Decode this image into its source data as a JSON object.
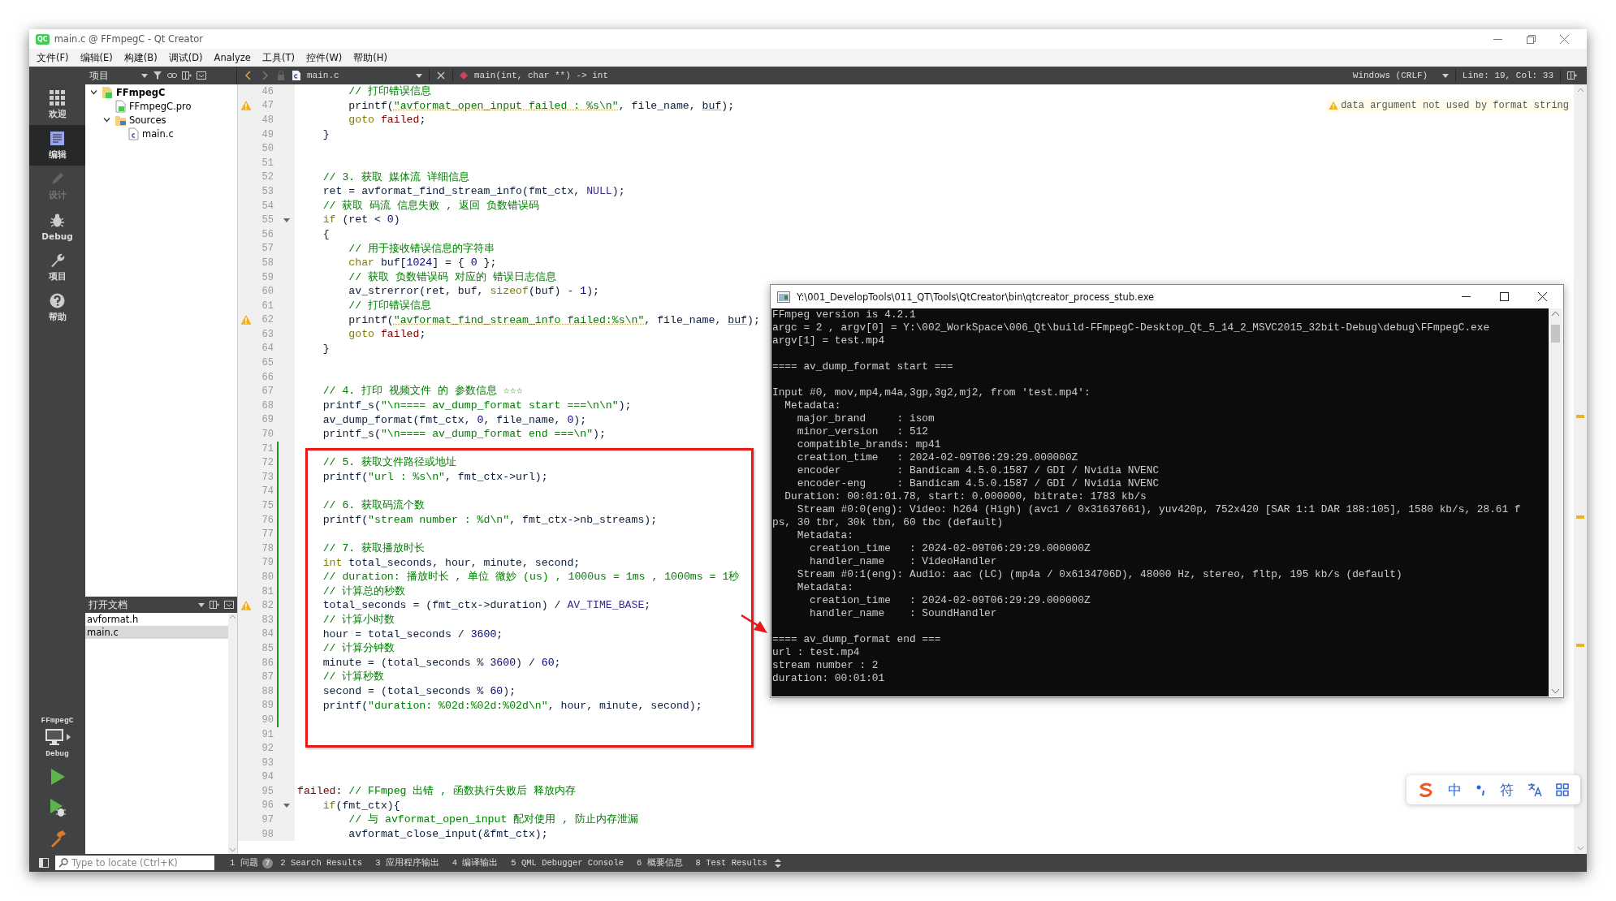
{
  "window": {
    "logo": "QC",
    "title": "main.c @ FFmpegC - Qt Creator"
  },
  "menu": [
    "文件(F)",
    "编辑(E)",
    "构建(B)",
    "调试(D)",
    "Analyze",
    "工具(T)",
    "控件(W)",
    "帮助(H)"
  ],
  "toolbar": {
    "panel_label": "项目",
    "file": "main.c",
    "symbol": "main(int, char **) -> int",
    "line_ending": "Windows (CRLF)",
    "position": "Line: 19, Col: 33"
  },
  "mode_bar": {
    "items": [
      {
        "label": "欢迎",
        "selected": false,
        "disabled": false
      },
      {
        "label": "编辑",
        "selected": true,
        "disabled": false
      },
      {
        "label": "设计",
        "selected": false,
        "disabled": true
      },
      {
        "label": "Debug",
        "selected": false,
        "disabled": false
      },
      {
        "label": "项目",
        "selected": false,
        "disabled": false
      },
      {
        "label": "帮助",
        "selected": false,
        "disabled": false
      }
    ],
    "kit": {
      "project": "FFmpegC",
      "build": "Debug"
    }
  },
  "project_tree": [
    {
      "label": "FFmpegC",
      "kind": "project",
      "expanded": true,
      "children": [
        {
          "label": "FFmpegC.pro",
          "kind": "pro"
        },
        {
          "label": "Sources",
          "kind": "folder",
          "expanded": true,
          "children": [
            {
              "label": "main.c",
              "kind": "source"
            }
          ]
        }
      ]
    }
  ],
  "open_documents": {
    "title": "打开文档",
    "items": [
      {
        "label": "avformat.h",
        "selected": false
      },
      {
        "label": "main.c",
        "selected": true
      }
    ]
  },
  "code": {
    "lines": [
      {
        "number": "46",
        "warning": false,
        "changed": false,
        "foldable": false,
        "segments": [
          {
            "kind": "comment",
            "text": "        // 打印错误信息"
          }
        ]
      },
      {
        "number": "47",
        "warning": true,
        "changed": false,
        "foldable": false,
        "annotation": "data argument not used by format string",
        "segments": [
          {
            "kind": "plain",
            "text": "        printf("
          },
          {
            "kind": "warn_string",
            "text": "\"avformat_open_input failed : %s\\n\""
          },
          {
            "kind": "plain",
            "text": ", file_name, "
          },
          {
            "kind": "warn_plain",
            "text": "buf"
          },
          {
            "kind": "plain",
            "text": ");"
          }
        ]
      },
      {
        "number": "48",
        "warning": false,
        "changed": false,
        "foldable": false,
        "segments": [
          {
            "kind": "keyword",
            "text": "        goto "
          },
          {
            "kind": "label",
            "text": "failed"
          },
          {
            "kind": "plain",
            "text": ";"
          }
        ]
      },
      {
        "number": "49",
        "warning": false,
        "changed": false,
        "foldable": false,
        "segments": [
          {
            "kind": "plain",
            "text": "    }"
          }
        ]
      },
      {
        "number": "50",
        "warning": false,
        "changed": false,
        "foldable": false
      },
      {
        "number": "51",
        "warning": false,
        "changed": false,
        "foldable": false
      },
      {
        "number": "52",
        "warning": false,
        "changed": false,
        "foldable": false,
        "segments": [
          {
            "kind": "comment",
            "text": "    // 3. 获取 媒体流 详细信息"
          }
        ]
      },
      {
        "number": "53",
        "warning": false,
        "changed": false,
        "foldable": false,
        "segments": [
          {
            "kind": "plain",
            "text": "    ret = avformat_find_stream_info(fmt_ctx, "
          },
          {
            "kind": "macro",
            "text": "NULL"
          },
          {
            "kind": "plain",
            "text": ");"
          }
        ]
      },
      {
        "number": "54",
        "warning": false,
        "changed": false,
        "foldable": false,
        "segments": [
          {
            "kind": "comment",
            "text": "    // 获取 码流 信息失败 , 返回 负数错误码"
          }
        ]
      },
      {
        "number": "55",
        "warning": false,
        "changed": false,
        "foldable": true,
        "segments": [
          {
            "kind": "keyword",
            "text": "    if"
          },
          {
            "kind": "plain",
            "text": " (ret < "
          },
          {
            "kind": "number",
            "text": "0"
          },
          {
            "kind": "plain",
            "text": ")"
          }
        ]
      },
      {
        "number": "56",
        "warning": false,
        "changed": false,
        "foldable": false,
        "segments": [
          {
            "kind": "plain",
            "text": "    {"
          }
        ]
      },
      {
        "number": "57",
        "warning": false,
        "changed": false,
        "foldable": false,
        "segments": [
          {
            "kind": "comment",
            "text": "        // 用于接收错误信息的字符串"
          }
        ]
      },
      {
        "number": "58",
        "warning": false,
        "changed": false,
        "foldable": false,
        "segments": [
          {
            "kind": "keyword",
            "text": "        char"
          },
          {
            "kind": "plain",
            "text": " buf["
          },
          {
            "kind": "number",
            "text": "1024"
          },
          {
            "kind": "plain",
            "text": "] = { "
          },
          {
            "kind": "number",
            "text": "0"
          },
          {
            "kind": "plain",
            "text": " };"
          }
        ]
      },
      {
        "number": "59",
        "warning": false,
        "changed": false,
        "foldable": false,
        "segments": [
          {
            "kind": "comment",
            "text": "        // 获取 负数错误码 对应的 错误日志信息"
          }
        ]
      },
      {
        "number": "60",
        "warning": false,
        "changed": false,
        "foldable": false,
        "segments": [
          {
            "kind": "plain",
            "text": "        av_strerror(ret, buf, "
          },
          {
            "kind": "keyword",
            "text": "sizeof"
          },
          {
            "kind": "plain",
            "text": "(buf) - "
          },
          {
            "kind": "number",
            "text": "1"
          },
          {
            "kind": "plain",
            "text": ");"
          }
        ]
      },
      {
        "number": "61",
        "warning": false,
        "changed": false,
        "foldable": false,
        "segments": [
          {
            "kind": "comment",
            "text": "        // 打印错误信息"
          }
        ]
      },
      {
        "number": "62",
        "warning": true,
        "changed": false,
        "foldable": false,
        "segments": [
          {
            "kind": "plain",
            "text": "        printf("
          },
          {
            "kind": "warn_string",
            "text": "\"avformat_find_stream_info failed:%s\\n\""
          },
          {
            "kind": "plain",
            "text": ", file_name, "
          },
          {
            "kind": "warn_plain",
            "text": "buf"
          },
          {
            "kind": "plain",
            "text": ");"
          }
        ]
      },
      {
        "number": "63",
        "warning": false,
        "changed": false,
        "foldable": false,
        "segments": [
          {
            "kind": "keyword",
            "text": "        goto "
          },
          {
            "kind": "label",
            "text": "failed"
          },
          {
            "kind": "plain",
            "text": ";"
          }
        ]
      },
      {
        "number": "64",
        "warning": false,
        "changed": false,
        "foldable": false,
        "segments": [
          {
            "kind": "plain",
            "text": "    }"
          }
        ]
      },
      {
        "number": "65",
        "warning": false,
        "changed": false,
        "foldable": false
      },
      {
        "number": "66",
        "warning": false,
        "changed": false,
        "foldable": false
      },
      {
        "number": "67",
        "warning": false,
        "changed": false,
        "foldable": false,
        "segments": [
          {
            "kind": "comment",
            "text": "    // 4. 打印 视频文件 的 参数信息 ☆☆☆"
          }
        ]
      },
      {
        "number": "68",
        "warning": false,
        "changed": false,
        "foldable": false,
        "segments": [
          {
            "kind": "plain",
            "text": "    printf_s("
          },
          {
            "kind": "string",
            "text": "\"\\n==== av_dump_format start ===\\n\\n\""
          },
          {
            "kind": "plain",
            "text": ");"
          }
        ]
      },
      {
        "number": "69",
        "warning": false,
        "changed": false,
        "foldable": false,
        "segments": [
          {
            "kind": "plain",
            "text": "    av_dump_format(fmt_ctx, "
          },
          {
            "kind": "number",
            "text": "0"
          },
          {
            "kind": "plain",
            "text": ", file_name, "
          },
          {
            "kind": "number",
            "text": "0"
          },
          {
            "kind": "plain",
            "text": ");"
          }
        ]
      },
      {
        "number": "70",
        "warning": false,
        "changed": false,
        "foldable": false,
        "segments": [
          {
            "kind": "plain",
            "text": "    printf_s("
          },
          {
            "kind": "string",
            "text": "\"\\n==== av_dump_format end ===\\n\""
          },
          {
            "kind": "plain",
            "text": ");"
          }
        ]
      },
      {
        "number": "71",
        "warning": false,
        "changed": true,
        "foldable": false
      },
      {
        "number": "72",
        "warning": false,
        "changed": true,
        "foldable": false,
        "segments": [
          {
            "kind": "comment",
            "text": "    // 5. 获取文件路径或地址"
          }
        ]
      },
      {
        "number": "73",
        "warning": false,
        "changed": true,
        "foldable": false,
        "segments": [
          {
            "kind": "plain",
            "text": "    printf("
          },
          {
            "kind": "string",
            "text": "\"url : %s\\n\""
          },
          {
            "kind": "plain",
            "text": ", fmt_ctx->url);"
          }
        ]
      },
      {
        "number": "74",
        "warning": false,
        "changed": true,
        "foldable": false
      },
      {
        "number": "75",
        "warning": false,
        "changed": true,
        "foldable": false,
        "segments": [
          {
            "kind": "comment",
            "text": "    // 6. 获取码流个数"
          }
        ]
      },
      {
        "number": "76",
        "warning": false,
        "changed": true,
        "foldable": false,
        "segments": [
          {
            "kind": "plain",
            "text": "    printf("
          },
          {
            "kind": "string",
            "text": "\"stream number : %d\\n\""
          },
          {
            "kind": "plain",
            "text": ", fmt_ctx->nb_streams);"
          }
        ]
      },
      {
        "number": "77",
        "warning": false,
        "changed": true,
        "foldable": false
      },
      {
        "number": "78",
        "warning": false,
        "changed": true,
        "foldable": false,
        "segments": [
          {
            "kind": "comment",
            "text": "    // 7. 获取播放时长"
          }
        ]
      },
      {
        "number": "79",
        "warning": false,
        "changed": true,
        "foldable": false,
        "segments": [
          {
            "kind": "keyword",
            "text": "    int"
          },
          {
            "kind": "plain",
            "text": " total_seconds, hour, minute, second;"
          }
        ]
      },
      {
        "number": "80",
        "warning": false,
        "changed": true,
        "foldable": false,
        "segments": [
          {
            "kind": "comment",
            "text": "    // duration: 播放时长 , 单位 微妙 (us) , 1000us = 1ms , 1000ms = 1秒"
          }
        ]
      },
      {
        "number": "81",
        "warning": false,
        "changed": true,
        "foldable": false,
        "segments": [
          {
            "kind": "comment",
            "text": "    // 计算总的秒数"
          }
        ]
      },
      {
        "number": "82",
        "warning": true,
        "changed": true,
        "foldable": false,
        "segments": [
          {
            "kind": "plain",
            "text": "    total_seconds = (fmt_ctx->duration) / "
          },
          {
            "kind": "macro",
            "text": "AV_TIME_BASE"
          },
          {
            "kind": "plain",
            "text": ";"
          }
        ]
      },
      {
        "number": "83",
        "warning": false,
        "changed": true,
        "foldable": false,
        "segments": [
          {
            "kind": "comment",
            "text": "    // 计算小时数"
          }
        ]
      },
      {
        "number": "84",
        "warning": false,
        "changed": true,
        "foldable": false,
        "segments": [
          {
            "kind": "plain",
            "text": "    hour = total_seconds / "
          },
          {
            "kind": "number",
            "text": "3600"
          },
          {
            "kind": "plain",
            "text": ";"
          }
        ]
      },
      {
        "number": "85",
        "warning": false,
        "changed": true,
        "foldable": false,
        "segments": [
          {
            "kind": "comment",
            "text": "    // 计算分钟数"
          }
        ]
      },
      {
        "number": "86",
        "warning": false,
        "changed": true,
        "foldable": false,
        "segments": [
          {
            "kind": "plain",
            "text": "    minute = (total_seconds % "
          },
          {
            "kind": "number",
            "text": "3600"
          },
          {
            "kind": "plain",
            "text": ") / "
          },
          {
            "kind": "number",
            "text": "60"
          },
          {
            "kind": "plain",
            "text": ";"
          }
        ]
      },
      {
        "number": "87",
        "warning": false,
        "changed": true,
        "foldable": false,
        "segments": [
          {
            "kind": "comment",
            "text": "    // 计算秒数"
          }
        ]
      },
      {
        "number": "88",
        "warning": false,
        "changed": true,
        "foldable": false,
        "segments": [
          {
            "kind": "plain",
            "text": "    second = (total_seconds % "
          },
          {
            "kind": "number",
            "text": "60"
          },
          {
            "kind": "plain",
            "text": ");"
          }
        ]
      },
      {
        "number": "89",
        "warning": false,
        "changed": true,
        "foldable": false,
        "segments": [
          {
            "kind": "plain",
            "text": "    printf("
          },
          {
            "kind": "string",
            "text": "\"duration: %02d:%02d:%02d\\n\""
          },
          {
            "kind": "plain",
            "text": ", hour, minute, second);"
          }
        ]
      },
      {
        "number": "90",
        "warning": false,
        "changed": true,
        "foldable": false
      },
      {
        "number": "91",
        "warning": false,
        "changed": false,
        "foldable": false
      },
      {
        "number": "92",
        "warning": false,
        "changed": false,
        "foldable": false
      },
      {
        "number": "93",
        "warning": false,
        "changed": false,
        "foldable": false
      },
      {
        "number": "94",
        "warning": false,
        "changed": false,
        "foldable": false
      },
      {
        "number": "95",
        "warning": false,
        "changed": false,
        "foldable": false,
        "segments": [
          {
            "kind": "label",
            "text": "failed"
          },
          {
            "kind": "plain",
            "text": ": "
          },
          {
            "kind": "comment",
            "text": "// FFmpeg 出错 , 函数执行失败后 释放内存"
          }
        ]
      },
      {
        "number": "96",
        "warning": false,
        "changed": false,
        "foldable": true,
        "segments": [
          {
            "kind": "keyword",
            "text": "    if"
          },
          {
            "kind": "plain",
            "text": "(fmt_ctx){"
          }
        ]
      },
      {
        "number": "97",
        "warning": false,
        "changed": false,
        "foldable": false,
        "segments": [
          {
            "kind": "comment",
            "text": "        // 与 avformat_open_input 配对使用 , 防止内存泄漏"
          }
        ]
      },
      {
        "number": "98",
        "warning": false,
        "changed": false,
        "foldable": false,
        "segments": [
          {
            "kind": "plain",
            "text": "        avformat_close_input(&fmt_ctx);"
          }
        ]
      }
    ]
  },
  "console": {
    "title": "Y:\\001_DevelopTools\\011_QT\\Tools\\QtCreator\\bin\\qtcreator_process_stub.exe",
    "paragraphs": [
      [
        "FFmpeg version is 4.2.1",
        "argc = 2 , argv[0] = Y:\\002_WorkSpace\\006_Qt\\build-FFmpegC-Desktop_Qt_5_14_2_MSVC2015_32bit-Debug\\debug\\FFmpegC.exe",
        "argv[1] = test.mp4"
      ],
      [
        "==== av_dump_format start ==="
      ],
      [
        "Input #0, mov,mp4,m4a,3gp,3g2,mj2, from 'test.mp4':",
        "  Metadata:",
        "    major_brand     : isom",
        "    minor_version   : 512",
        "    compatible_brands: mp41",
        "    creation_time   : 2024-02-09T06:29:29.000000Z",
        "    encoder         : Bandicam 4.5.0.1587 / GDI / Nvidia NVENC",
        "    encoder-eng     : Bandicam 4.5.0.1587 / GDI / Nvidia NVENC",
        "  Duration: 00:01:01.78, start: 0.000000, bitrate: 1783 kb/s",
        "    Stream #0:0(eng): Video: h264 (High) (avc1 / 0x31637661), yuv420p, 752x420 [SAR 1:1 DAR 188:105], 1580 kb/s, 28.61 f",
        "ps, 30 tbr, 30k tbn, 60 tbc (default)",
        "    Metadata:",
        "      creation_time   : 2024-02-09T06:29:29.000000Z",
        "      handler_name    : VideoHandler",
        "    Stream #0:1(eng): Audio: aac (LC) (mp4a / 0x6134706D), 48000 Hz, stereo, fltp, 195 kb/s (default)",
        "    Metadata:",
        "      creation_time   : 2024-02-09T06:29:29.000000Z",
        "      handler_name    : SoundHandler"
      ],
      [
        "==== av_dump_format end ===",
        "url : test.mp4",
        "stream number : 2",
        "duration: 00:01:01"
      ]
    ]
  },
  "status_bar": {
    "locate_placeholder": "Type to locate (Ctrl+K)",
    "panes": [
      {
        "number": "1",
        "label": "问题",
        "badge": "7"
      },
      {
        "number": "2",
        "label": "Search Results"
      },
      {
        "number": "3",
        "label": "应用程序输出"
      },
      {
        "number": "4",
        "label": "编译输出"
      },
      {
        "number": "5",
        "label": "QML Debugger Console"
      },
      {
        "number": "6",
        "label": "概要信息"
      },
      {
        "number": "8",
        "label": "Test Results"
      }
    ]
  },
  "ime_bar": {
    "language": "中",
    "symbols": "符"
  }
}
